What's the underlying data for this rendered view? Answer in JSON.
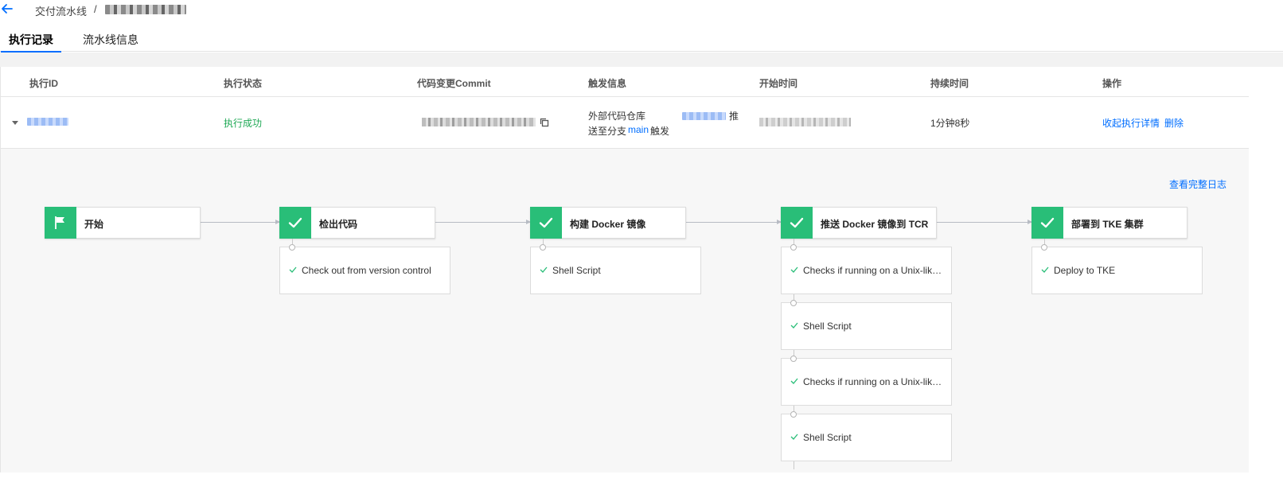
{
  "header": {
    "breadcrumb_root": "交付流水线",
    "breadcrumb_sep": "/"
  },
  "tabs": [
    {
      "label": "执行记录",
      "active": true
    },
    {
      "label": "流水线信息",
      "active": false
    }
  ],
  "table": {
    "columns": [
      "执行ID",
      "执行状态",
      "代码变更Commit",
      "触发信息",
      "开始时间",
      "持续时间",
      "操作"
    ],
    "row": {
      "status": "执行成功",
      "trigger_prefix": "外部代码仓库",
      "trigger_push": "推",
      "trigger_line2_a": "送至分支",
      "trigger_branch": "main",
      "trigger_line2_b": "触发",
      "duration": "1分钟8秒",
      "action_collapse": "收起执行详情",
      "action_delete": "删除"
    }
  },
  "detail": {
    "full_log_link": "查看完整日志",
    "stages": [
      {
        "name": "开始",
        "icon": "flag-icon"
      },
      {
        "name": "检出代码",
        "icon": "check-icon"
      },
      {
        "name": "构建 Docker 镜像",
        "icon": "check-icon"
      },
      {
        "name": "推送 Docker 镜像到 TCR",
        "icon": "check-icon"
      },
      {
        "name": "部署到 TKE 集群",
        "icon": "check-icon"
      }
    ],
    "steps": {
      "checkout": [
        "Check out from version control"
      ],
      "build": [
        "Shell Script"
      ],
      "push": [
        "Checks if running on a Unix-like node",
        "Shell Script",
        "Checks if running on a Unix-like node",
        "Shell Script"
      ],
      "deploy": [
        "Deploy to TKE"
      ]
    }
  },
  "colors": {
    "accent": "#006eff",
    "success": "#29be78",
    "status_text": "#20a956"
  }
}
